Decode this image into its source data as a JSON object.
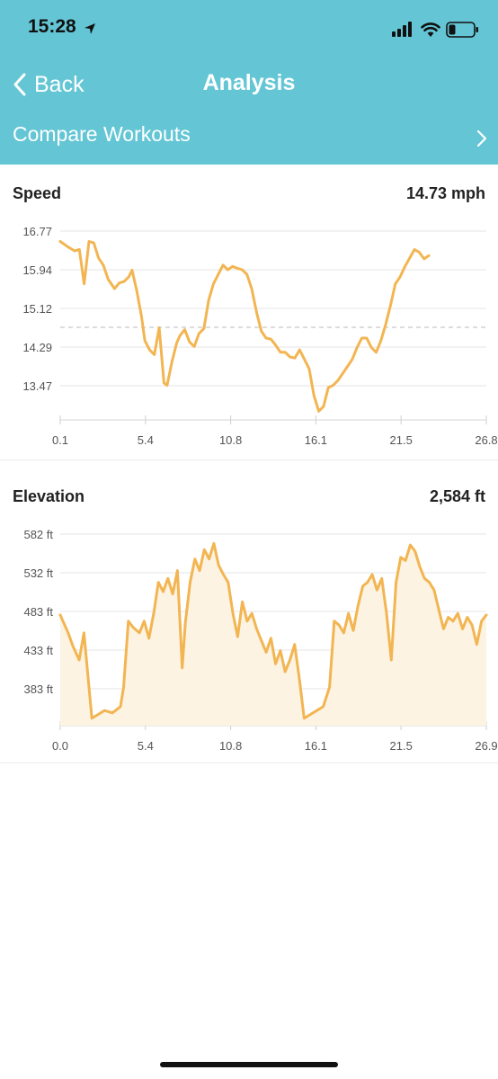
{
  "status_bar": {
    "time": "15:28"
  },
  "nav": {
    "back_label": "Back",
    "title": "Analysis"
  },
  "compare": {
    "label": "Compare Workouts"
  },
  "speed": {
    "title": "Speed",
    "value": "14.73 mph",
    "chart_data": {
      "type": "line",
      "title": "Speed",
      "xlabel": "",
      "ylabel": "",
      "x_ticks": [
        "0.1",
        "5.4",
        "10.8",
        "16.1",
        "21.5",
        "26.8"
      ],
      "y_ticks": [
        "16.77",
        "15.94",
        "15.12",
        "14.29",
        "13.47"
      ],
      "xlim": [
        0.1,
        26.8
      ],
      "ylim": [
        12.85,
        16.77
      ],
      "average_line": 14.73,
      "line_color": "#f2b552",
      "x": [
        0.1,
        0.6,
        1.0,
        1.3,
        1.6,
        1.9,
        2.2,
        2.5,
        2.8,
        3.1,
        3.5,
        3.8,
        4.1,
        4.4,
        4.6,
        4.9,
        5.2,
        5.4,
        5.7,
        6.0,
        6.3,
        6.6,
        6.8,
        7.1,
        7.4,
        7.6,
        7.9,
        8.2,
        8.5,
        8.8,
        9.1,
        9.4,
        9.7,
        10.0,
        10.3,
        10.6,
        10.9,
        11.2,
        11.5,
        11.8,
        12.1,
        12.4,
        12.7,
        13.0,
        13.3,
        13.6,
        13.9,
        14.2,
        14.5,
        14.8,
        15.1,
        15.4,
        15.7,
        16.0,
        16.3,
        16.6,
        16.9,
        17.2,
        17.5,
        17.8,
        18.1,
        18.4,
        18.7,
        19.0,
        19.3,
        19.6,
        19.9,
        20.2,
        20.5,
        20.8,
        21.1,
        21.4,
        21.7,
        22.0,
        22.3,
        22.6,
        22.9,
        23.2,
        23.5,
        23.8,
        24.1,
        24.4,
        24.7,
        25.0,
        25.3,
        25.6,
        25.9,
        26.2,
        26.5,
        26.8
      ],
      "y": [
        16.55,
        16.43,
        16.35,
        16.38,
        15.65,
        16.55,
        16.52,
        16.2,
        16.05,
        15.75,
        15.55,
        15.67,
        15.7,
        15.8,
        15.94,
        15.5,
        14.95,
        14.45,
        14.25,
        14.15,
        14.72,
        13.55,
        13.5,
        14.0,
        14.4,
        14.55,
        14.68,
        14.42,
        14.32,
        14.6,
        14.7,
        15.3,
        15.65,
        15.85,
        16.05,
        15.95,
        16.02,
        15.98,
        15.95,
        15.85,
        15.55,
        15.05,
        14.65,
        14.5,
        14.48,
        14.35,
        14.2,
        14.2,
        14.1,
        14.08,
        14.25,
        14.05,
        13.85,
        13.28,
        12.95,
        13.05,
        13.45,
        13.5,
        13.6,
        13.75,
        13.9,
        14.05,
        14.3,
        14.5,
        14.5,
        14.3,
        14.2,
        14.45,
        14.8,
        15.2,
        15.65,
        15.8,
        16.02,
        16.2,
        16.38,
        16.32,
        16.18,
        16.25
      ]
    }
  },
  "elevation": {
    "title": "Elevation",
    "value": "2,584 ft",
    "chart_data": {
      "type": "area",
      "title": "Elevation",
      "xlabel": "",
      "ylabel": "",
      "x_ticks": [
        "0.0",
        "5.4",
        "10.8",
        "16.1",
        "21.5",
        "26.9"
      ],
      "y_ticks": [
        "582 ft",
        "532 ft",
        "483 ft",
        "433 ft",
        "383 ft"
      ],
      "xlim": [
        0.0,
        26.9
      ],
      "ylim": [
        333,
        582
      ],
      "line_color": "#f2b552",
      "fill_color": "#fdf3e2",
      "x": [
        0.0,
        0.5,
        0.8,
        1.2,
        1.5,
        1.7,
        2.0,
        2.4,
        2.8,
        3.3,
        3.8,
        4.0,
        4.3,
        4.6,
        5.0,
        5.3,
        5.6,
        5.9,
        6.2,
        6.5,
        6.8,
        7.1,
        7.4,
        7.7,
        7.9,
        8.2,
        8.5,
        8.8,
        9.1,
        9.4,
        9.7,
        10.0,
        10.3,
        10.6,
        10.9,
        11.2,
        11.5,
        11.8,
        12.1,
        12.4,
        12.7,
        13.0,
        13.3,
        13.6,
        13.9,
        14.2,
        14.5,
        14.8,
        15.1,
        15.4,
        15.8,
        16.2,
        16.6,
        17.0,
        17.3,
        17.6,
        17.9,
        18.2,
        18.5,
        18.8,
        19.1,
        19.4,
        19.7,
        20.0,
        20.3,
        20.6,
        20.9,
        21.2,
        21.5,
        21.8,
        22.1,
        22.4,
        22.7,
        23.0,
        23.3,
        23.6,
        23.9,
        24.2,
        24.5,
        24.8,
        25.1,
        25.4,
        25.7,
        26.0,
        26.3,
        26.6,
        26.9
      ],
      "y": [
        478,
        455,
        438,
        420,
        455,
        410,
        345,
        350,
        355,
        352,
        360,
        385,
        470,
        462,
        455,
        470,
        448,
        480,
        520,
        508,
        525,
        505,
        535,
        410,
        468,
        520,
        550,
        535,
        562,
        550,
        570,
        542,
        530,
        520,
        480,
        450,
        495,
        470,
        480,
        460,
        445,
        430,
        448,
        415,
        432,
        405,
        420,
        440,
        395,
        345,
        350,
        355,
        360,
        385,
        470,
        465,
        455,
        480,
        458,
        490,
        515,
        520,
        530,
        510,
        525,
        480,
        420,
        520,
        552,
        548,
        568,
        560,
        540,
        525,
        520,
        510,
        485,
        460,
        475,
        470,
        480,
        460,
        475,
        465,
        440,
        470,
        478
      ]
    }
  }
}
